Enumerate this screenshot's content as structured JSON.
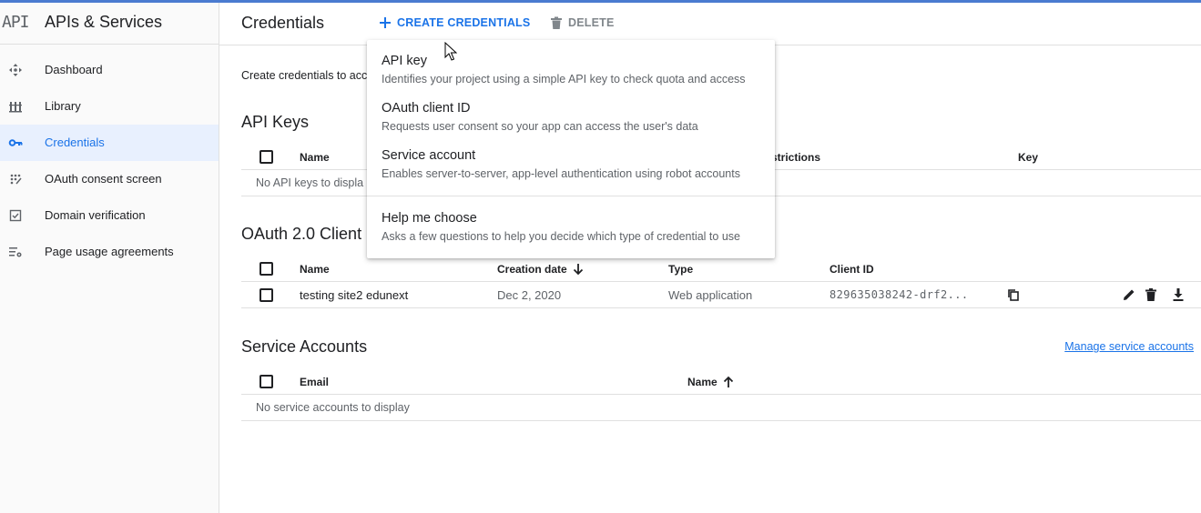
{
  "sidebar": {
    "logo": "API",
    "title": "APIs & Services",
    "items": [
      {
        "label": "Dashboard",
        "icon": "dashboard-icon"
      },
      {
        "label": "Library",
        "icon": "library-icon"
      },
      {
        "label": "Credentials",
        "icon": "key-icon",
        "active": true
      },
      {
        "label": "OAuth consent screen",
        "icon": "consent-icon"
      },
      {
        "label": "Domain verification",
        "icon": "checkbox-icon"
      },
      {
        "label": "Page usage agreements",
        "icon": "settings-list-icon"
      }
    ]
  },
  "header": {
    "title": "Credentials",
    "create_label": "CREATE CREDENTIALS",
    "delete_label": "DELETE"
  },
  "main": {
    "intro": "Create credentials to acc",
    "api_keys": {
      "title": "API Keys",
      "columns": [
        "Name",
        "strictions",
        "Key"
      ],
      "empty": "No API keys to displa"
    },
    "oauth": {
      "title": "OAuth 2.0 Client I",
      "columns": [
        "Name",
        "Creation date",
        "Type",
        "Client ID"
      ],
      "rows": [
        {
          "name": "testing site2 edunext",
          "date": "Dec 2, 2020",
          "type": "Web application",
          "client_id": "829635038242-drf2..."
        }
      ]
    },
    "service_accounts": {
      "title": "Service Accounts",
      "manage_link": "Manage service accounts",
      "columns": [
        "Email",
        "Name"
      ],
      "empty": "No service accounts to display"
    }
  },
  "menu": {
    "items": [
      {
        "title": "API key",
        "desc": "Identifies your project using a simple API key to check quota and access"
      },
      {
        "title": "OAuth client ID",
        "desc": "Requests user consent so your app can access the user's data"
      },
      {
        "title": "Service account",
        "desc": "Enables server-to-server, app-level authentication using robot accounts"
      },
      {
        "title": "Help me choose",
        "desc": "Asks a few questions to help you decide which type of credential to use"
      }
    ]
  },
  "colors": {
    "accent": "#1a73e8",
    "active_bg": "#e8f0fe",
    "text": "#202124",
    "muted": "#5f6368"
  }
}
